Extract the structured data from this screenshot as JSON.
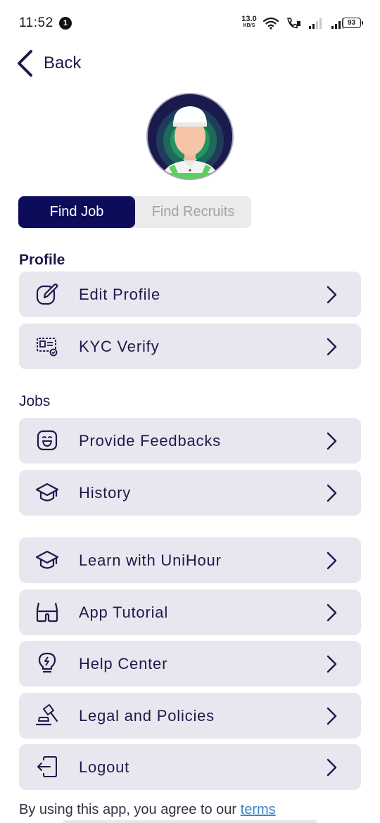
{
  "status": {
    "time": "11:52",
    "notification_count": "1",
    "net_speed_value": "13.0",
    "net_speed_unit": "KB/S",
    "battery": "93"
  },
  "nav": {
    "back_label": "Back"
  },
  "toggle": {
    "find_job": "Find Job",
    "find_recruits": "Find Recruits",
    "active": "find_job"
  },
  "sections": {
    "profile": "Profile",
    "jobs": "Jobs"
  },
  "menu": {
    "edit_profile": {
      "label": "Edit Profile",
      "icon": "edit-icon"
    },
    "kyc_verify": {
      "label": "KYC Verify",
      "icon": "id-card-verify-icon"
    },
    "provide_feedbacks": {
      "label": "Provide Feedbacks",
      "icon": "smiley-icon"
    },
    "history": {
      "label": "History",
      "icon": "graduation-cap-icon"
    },
    "learn": {
      "label": "Learn with UniHour",
      "icon": "graduation-cap-icon"
    },
    "app_tutorial": {
      "label": "App Tutorial",
      "icon": "glasses-icon"
    },
    "help_center": {
      "label": "Help Center",
      "icon": "lightbulb-icon"
    },
    "legal": {
      "label": "Legal and Policies",
      "icon": "gavel-icon"
    },
    "logout": {
      "label": "Logout",
      "icon": "logout-icon"
    }
  },
  "footer": {
    "text": "By using this app, you agree to our ",
    "link": "terms"
  },
  "colors": {
    "primary": "#0c0c5b",
    "card": "#e8e7ef",
    "text": "#1b1b4b",
    "link": "#3a86c8"
  }
}
